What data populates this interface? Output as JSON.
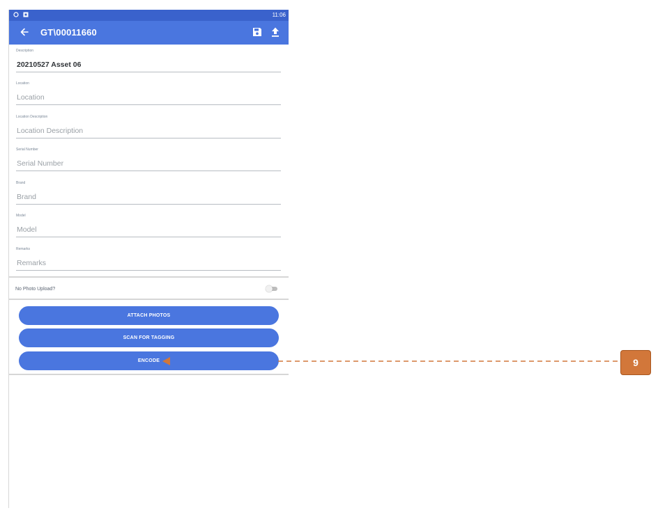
{
  "status_bar": {
    "time": "11:06",
    "icons": [
      "sync-icon",
      "notification-icon"
    ]
  },
  "app_bar": {
    "title": "GT\\00011660",
    "back_icon": "arrow-left-icon",
    "save_icon": "save-icon",
    "upload_icon": "upload-icon"
  },
  "fields": [
    {
      "label": "Description",
      "value": "20210527 Asset 06",
      "placeholder": ""
    },
    {
      "label": "Location",
      "value": "",
      "placeholder": "Location"
    },
    {
      "label": "Location Description",
      "value": "",
      "placeholder": "Location Description"
    },
    {
      "label": "Serial Number",
      "value": "",
      "placeholder": "Serial Number"
    },
    {
      "label": "Brand",
      "value": "",
      "placeholder": "Brand"
    },
    {
      "label": "Model",
      "value": "",
      "placeholder": "Model"
    },
    {
      "label": "Remarks",
      "value": "",
      "placeholder": "Remarks"
    }
  ],
  "toggle": {
    "label": "No Photo Upload?",
    "checked": false
  },
  "buttons": {
    "attach_photos": "ATTACH PHOTOS",
    "scan_for_tagging": "SCAN FOR TAGGING",
    "encode": "ENCODE"
  },
  "colors": {
    "primary": "#4a76df",
    "status_bar": "#3a62cc",
    "callout": "#d2773a"
  },
  "callout": {
    "number": "9"
  }
}
